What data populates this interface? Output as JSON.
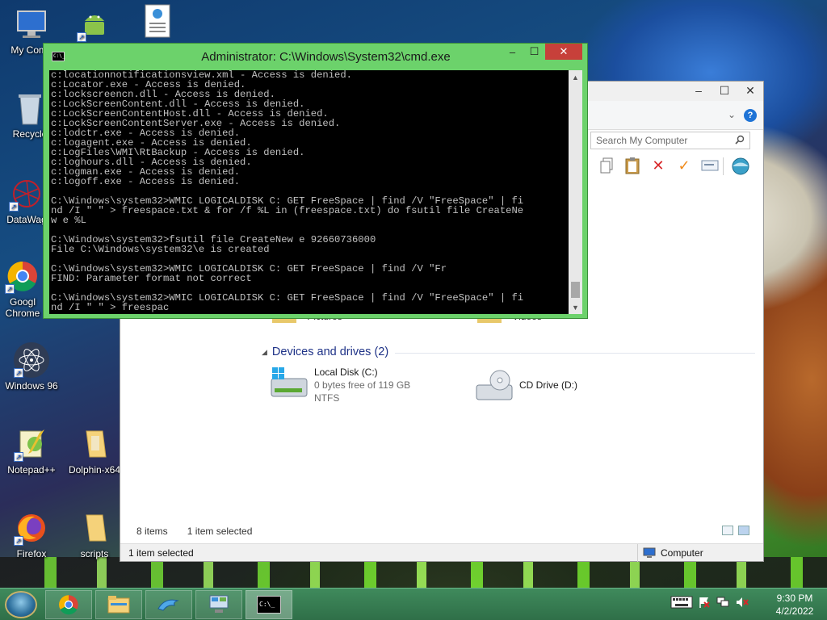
{
  "desktop": {
    "icons": [
      {
        "label": "My Comp",
        "icon": "computer-icon"
      },
      {
        "label": "",
        "icon": "android-icon"
      },
      {
        "label": "",
        "icon": "document-web-icon"
      },
      {
        "label": "Recycle",
        "icon": "recycle-bin-icon"
      },
      {
        "label": "DataWag",
        "icon": "datawag-icon"
      },
      {
        "label": "Googl Chrome",
        "icon": "chrome-icon"
      },
      {
        "label": "Windows 96",
        "icon": "atom-icon"
      },
      {
        "label": "Notepad++",
        "icon": "notepad-plus-plus-icon"
      },
      {
        "label": "Dolphin-x64",
        "icon": "folder-icon"
      },
      {
        "label": "Firefox",
        "icon": "firefox-icon"
      },
      {
        "label": "scripts",
        "icon": "folder-icon"
      }
    ]
  },
  "cmd": {
    "title": "Administrator: C:\\Windows\\System32\\cmd.exe",
    "text": "c:locationnotificationsview.xml - Access is denied.\nc:Locator.exe - Access is denied.\nc:lockscreencn.dll - Access is denied.\nc:LockScreenContent.dll - Access is denied.\nc:LockScreenContentHost.dll - Access is denied.\nc:LockScreenContentServer.exe - Access is denied.\nc:lodctr.exe - Access is denied.\nc:logagent.exe - Access is denied.\nc:LogFiles\\WMI\\RtBackup - Access is denied.\nc:loghours.dll - Access is denied.\nc:logman.exe - Access is denied.\nc:logoff.exe - Access is denied.\n\nC:\\Windows\\system32>WMIC LOGICALDISK C: GET FreeSpace | find /V \"FreeSpace\" | fi\nnd /I \" \" > freespace.txt & for /f %L in (freespace.txt) do fsutil file CreateNe\nw e %L\n\nC:\\Windows\\system32>fsutil file CreateNew e 92660736000\nFile C:\\Windows\\system32\\e is created\n\nC:\\Windows\\system32>WMIC LOGICALDISK C: GET FreeSpace | find /V \"Fr\nFIND: Parameter format not correct\n\nC:\\Windows\\system32>WMIC LOGICALDISK C: GET FreeSpace | find /V \"FreeSpace\" | fi\nnd /I \" \" > freespac",
    "minimize": "–",
    "maximize": "☐",
    "close": "✕"
  },
  "explorer": {
    "minimize": "–",
    "maximize": "☐",
    "close": "✕",
    "search_placeholder": "Search My Computer",
    "partial_folders": [
      "Pictures",
      "Videos"
    ],
    "devices_header": "Devices and drives (2)",
    "drives": [
      {
        "name": "Local Disk (C:)",
        "free": "0 bytes free of 119 GB",
        "fs": "NTFS"
      },
      {
        "name": "CD Drive (D:)",
        "free": "",
        "fs": ""
      }
    ],
    "item_count": "8 items",
    "selected_count": "1 item selected",
    "status_left": "1 item selected",
    "status_right": "Computer"
  },
  "taskbar": {
    "clock_time": "9:30 PM",
    "clock_date": "4/2/2022",
    "cmd_label": "C:\\_"
  }
}
